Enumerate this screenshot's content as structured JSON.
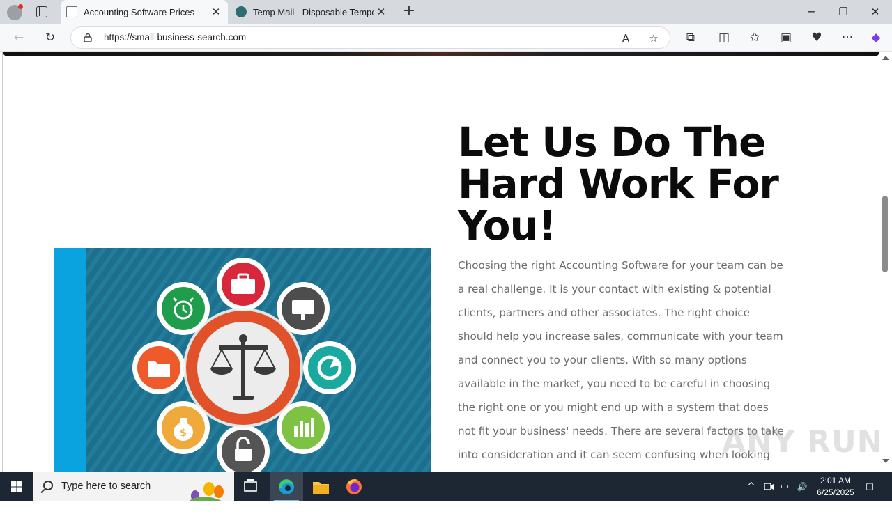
{
  "browser": {
    "tabs": [
      {
        "title": "Accounting Software Prices",
        "active": true
      },
      {
        "title": "Temp Mail - Disposable Temporar",
        "active": false
      }
    ],
    "new_tab_glyph": "+",
    "close_glyph": "✕",
    "window_controls": {
      "minimize": "─",
      "restore": "❐",
      "close": "✕"
    },
    "nav": {
      "back": "←",
      "reload": "↻"
    },
    "url": "https://small-business-search.com",
    "toolbar_glyphs": {
      "read_aloud": "A",
      "favorite": "☆",
      "extensions": "⧉",
      "split": "◫",
      "favorites": "✩",
      "collections": "▣",
      "performance": "♥",
      "menu": "···",
      "copilot": "◆"
    }
  },
  "page": {
    "heading": "Let Us Do The Hard Work For You!",
    "body": "Choosing the right Accounting Software for your team can be a real challenge. It is your contact with existing & potential clients, partners and other associates. The right choice should help you increase sales, communicate with your team and connect you to your clients. With so many options available in the market, you need to be careful in choosing the right one or you might end up with a system that does not fit your business' needs. There are several factors to take into consideration and it can seem confusing when looking for the",
    "watermark": "ANY RUN",
    "illustration_icons": [
      "briefcase-icon",
      "monitor-icon",
      "pie-chart-icon",
      "bar-chart-icon",
      "lock-icon",
      "money-bag-icon",
      "folder-icon",
      "alarm-clock-icon",
      "scales-icon"
    ],
    "colors": {
      "heading": "#0b0b0b",
      "body": "#6b6b6b",
      "illus_bg": "#1f6f8b",
      "accent_strip": "#0aa3e0",
      "center_ring": "#e2522a"
    }
  },
  "taskbar": {
    "search_placeholder": "Type here to search",
    "time": "2:01 AM",
    "date": "6/25/2025",
    "tray_glyphs": {
      "chevron": "^",
      "network": "▭",
      "volume": "🔊",
      "notification": "▢"
    }
  }
}
